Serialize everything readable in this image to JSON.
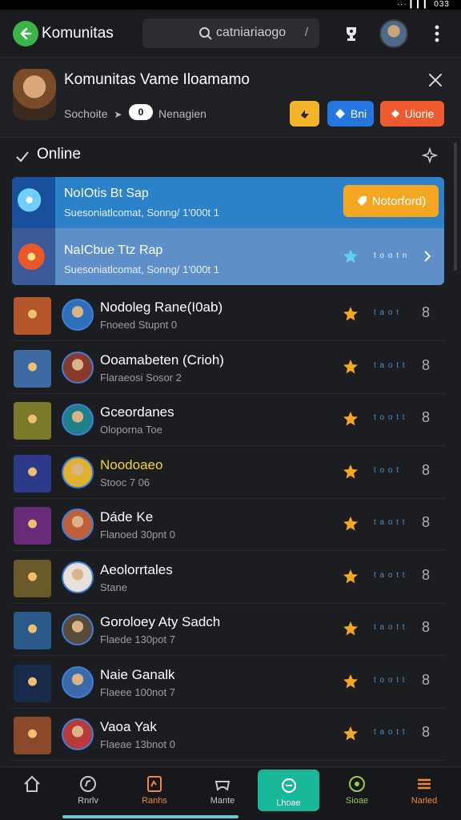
{
  "status": {
    "right_text": "··· ▎▎▎ 033"
  },
  "topbar": {
    "title": "Komunitas",
    "search_value": "catniariaogo",
    "search_slash": "/"
  },
  "community": {
    "title": "Komunitas Vame Iloamamo",
    "sub": "Sochoite",
    "badge": "0",
    "tag": "Nenagien",
    "btn_blue": "Bni",
    "btn_red": "Uiorie"
  },
  "online": {
    "label": "Online"
  },
  "highlight": [
    {
      "name": "NoIOtis Bt Sap",
      "sub": "Suesoniatlcomat, Sonng/ 1'000t 1",
      "action": "Notorford)"
    },
    {
      "name": "NaICbue Ttz Rap",
      "sub": "Suesoniatlcomat, Sonng/ 1'000t 1",
      "stat": "t o o t n"
    }
  ],
  "rows": [
    {
      "name": "Nodoleg Rane(I0ab)",
      "sub": "Fnoeed Stupnt 0",
      "stat": "t a o t",
      "more": "8",
      "game_color": "#b4552a",
      "ava_color": "#2f6fba"
    },
    {
      "name": "Ooamabeten (Crioh)",
      "sub": "Flaraeosi Sosor 2",
      "stat": "t a o t t",
      "more": "8",
      "game_color": "#3d6aa3",
      "ava_color": "#8a3a2a"
    },
    {
      "name": "Gceordanes",
      "sub": "Oloporna Toe",
      "stat": "t o o t t",
      "more": "8",
      "game_color": "#7a7a2a",
      "ava_color": "#1f7f8a"
    },
    {
      "name": "Noodoaeo",
      "sub": "Stooc 7 06",
      "stat": "t o o t",
      "more": "8",
      "game_color": "#2b3b8a",
      "ava_color": "#e0b030",
      "name_color": "#f2d13a"
    },
    {
      "name": "Dáde Ke",
      "sub": "Flanoed 30pnt 0",
      "stat": "t a o t t",
      "more": "8",
      "game_color": "#6a2a7a",
      "ava_color": "#c0603a"
    },
    {
      "name": "Aeolorrtales",
      "sub": "Stane",
      "stat": "t a o t t",
      "more": "8",
      "game_color": "#6a5a2a",
      "ava_color": "#e8e0d8"
    },
    {
      "name": "Goroloey Aty Sadch",
      "sub": "Flaede 130pot 7",
      "stat": "t a o t t",
      "more": "8",
      "game_color": "#2a5a8a",
      "ava_color": "#5a4a3a"
    },
    {
      "name": "Naie Ganalk",
      "sub": "Flaeee 100not 7",
      "stat": "t o o t t",
      "more": "8",
      "game_color": "#1a2a4a",
      "ava_color": "#3a6aa8"
    },
    {
      "name": "Vaoa Yak",
      "sub": "Flaeae 13bnot 0",
      "stat": "t a o t t",
      "more": "8",
      "game_color": "#8a4a2a",
      "ava_color": "#b83a3a"
    }
  ],
  "nav": [
    {
      "label": "",
      "icon": "home-icon",
      "color": "#c8c8cc"
    },
    {
      "label": "Rnrlv",
      "icon": "compass-icon",
      "color": "#c8c8cc"
    },
    {
      "label": "Ranhs",
      "icon": "rank-icon",
      "color": "#f08a3a"
    },
    {
      "label": "Mante",
      "icon": "gamepad-icon",
      "color": "#c8c8cc"
    },
    {
      "label": "Lhoae",
      "icon": "chat-icon",
      "color": "#ffffff"
    },
    {
      "label": "Sioae",
      "icon": "target-icon",
      "color": "#9ccc4a"
    },
    {
      "label": "Narled",
      "icon": "menu-icon",
      "color": "#f08a3a"
    }
  ]
}
